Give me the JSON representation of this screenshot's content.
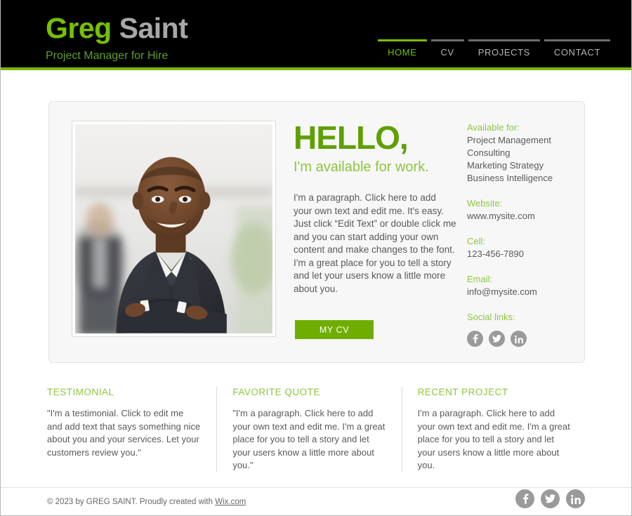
{
  "header": {
    "brand_first": "Greg",
    "brand_last": "Saint",
    "tagline": "Project Manager for Hire",
    "nav": [
      {
        "label": "HOME",
        "active": true
      },
      {
        "label": "CV",
        "active": false
      },
      {
        "label": "PROJECTS",
        "active": false
      },
      {
        "label": "CONTACT",
        "active": false
      }
    ]
  },
  "hero": {
    "photo_alt": "portrait-of-smiling-businessman-in-suit-with-arms-crossed",
    "heading": "HELLO,",
    "subheading": "I'm available for work.",
    "paragraph": "I'm a paragraph. Click here to add your own text and edit me. It's easy. Just click “Edit Text” or double click me and you can start adding your own content and make changes to the font. I'm a great place for you to tell a story and let your users know a little more about you.",
    "cv_button": "MY CV",
    "aside": {
      "available_label": "Available for:",
      "available_items": [
        "Project Management",
        "Consulting",
        "Marketing Strategy",
        "Business Intelligence"
      ],
      "website_label": "Website:",
      "website_value": "www.mysite.com",
      "cell_label": "Cell:",
      "cell_value": "123-456-7890",
      "email_label": "Email:",
      "email_value": "info@mysite.com",
      "social_label": "Social links:",
      "social_icons": [
        "facebook-icon",
        "twitter-icon",
        "linkedin-icon"
      ]
    }
  },
  "cards": [
    {
      "title": "TESTIMONIAL",
      "body": "\"I'm a testimonial. Click to edit me and add text that says something nice about you and your services. Let your customers review you.\""
    },
    {
      "title": "FAVORITE QUOTE",
      "body": "\"I'm a paragraph. Click here to add your own text and edit me. I'm a great place for you to tell a story and let your users know a little more about you.\""
    },
    {
      "title": "RECENT PROJECT",
      "body": "I'm a paragraph. Click here to add your own text and edit me. I'm a great place for you to tell a story and let your users know a little more about you."
    }
  ],
  "footer": {
    "text_before": "© 2023 by GREG SAINT. Proudly created with ",
    "link": "Wix.com",
    "social_icons": [
      "facebook-icon",
      "twitter-icon",
      "linkedin-icon"
    ]
  },
  "colors": {
    "brand_green": "#76c000",
    "accent_green": "#8ec63f",
    "heading_green": "#5ea000",
    "button_green": "#6fae00",
    "header_black": "#000000",
    "panel_bg": "#f7f7f7",
    "body_text": "#5a5a5a",
    "social_gray": "#9a9a9a"
  }
}
